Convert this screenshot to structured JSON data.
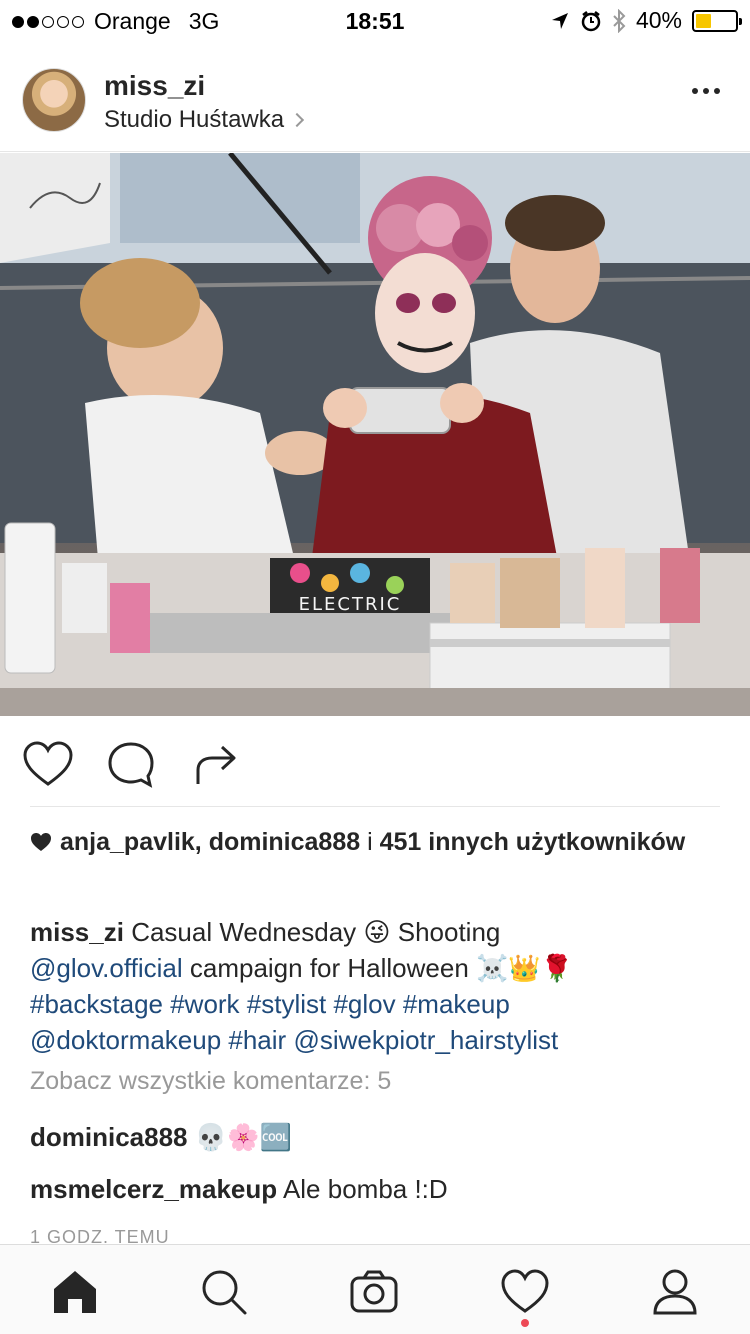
{
  "status_bar": {
    "carrier": "Orange",
    "network": "3G",
    "time": "18:51",
    "battery": "40%",
    "battery_level": 0.4,
    "signal_bars": 2
  },
  "post": {
    "username": "miss_zi",
    "location": "Studio Huśtawka",
    "photo_text": "ELECTRIC",
    "likes": {
      "names": "anja_pavlik, dominica888",
      "conjunction": "i",
      "others": "451 innych użytkowników"
    },
    "caption": {
      "author": "miss_zi",
      "text_1": "Casual Wednesday 😜 Shooting",
      "mention_1": "@glov.official",
      "text_2": "campaign for Halloween ☠️👑🌹",
      "tags_1": "#backstage #work #stylist #glov #makeup",
      "mention_2": "@doktormakeup",
      "tag_2": "#hair",
      "mention_3": "@siwekpiotr_hairstylist"
    },
    "view_all_comments": "Zobacz wszystkie komentarze: 5",
    "comments": [
      {
        "user": "dominica888",
        "text": "💀🌸🆒"
      },
      {
        "user": "msmelcerz_makeup",
        "text": "Ale bomba !:D"
      }
    ],
    "timestamp": "1 GODZ. TEMU"
  },
  "icons": {
    "like": "heart-icon",
    "comment": "comment-icon",
    "share": "share-icon",
    "home": "home-icon",
    "search": "search-icon",
    "camera": "camera-icon",
    "activity": "heart-icon",
    "profile": "profile-icon"
  },
  "colors": {
    "link": "#1f4a7a",
    "battery": "#f7c600",
    "notification": "#ed4956"
  }
}
